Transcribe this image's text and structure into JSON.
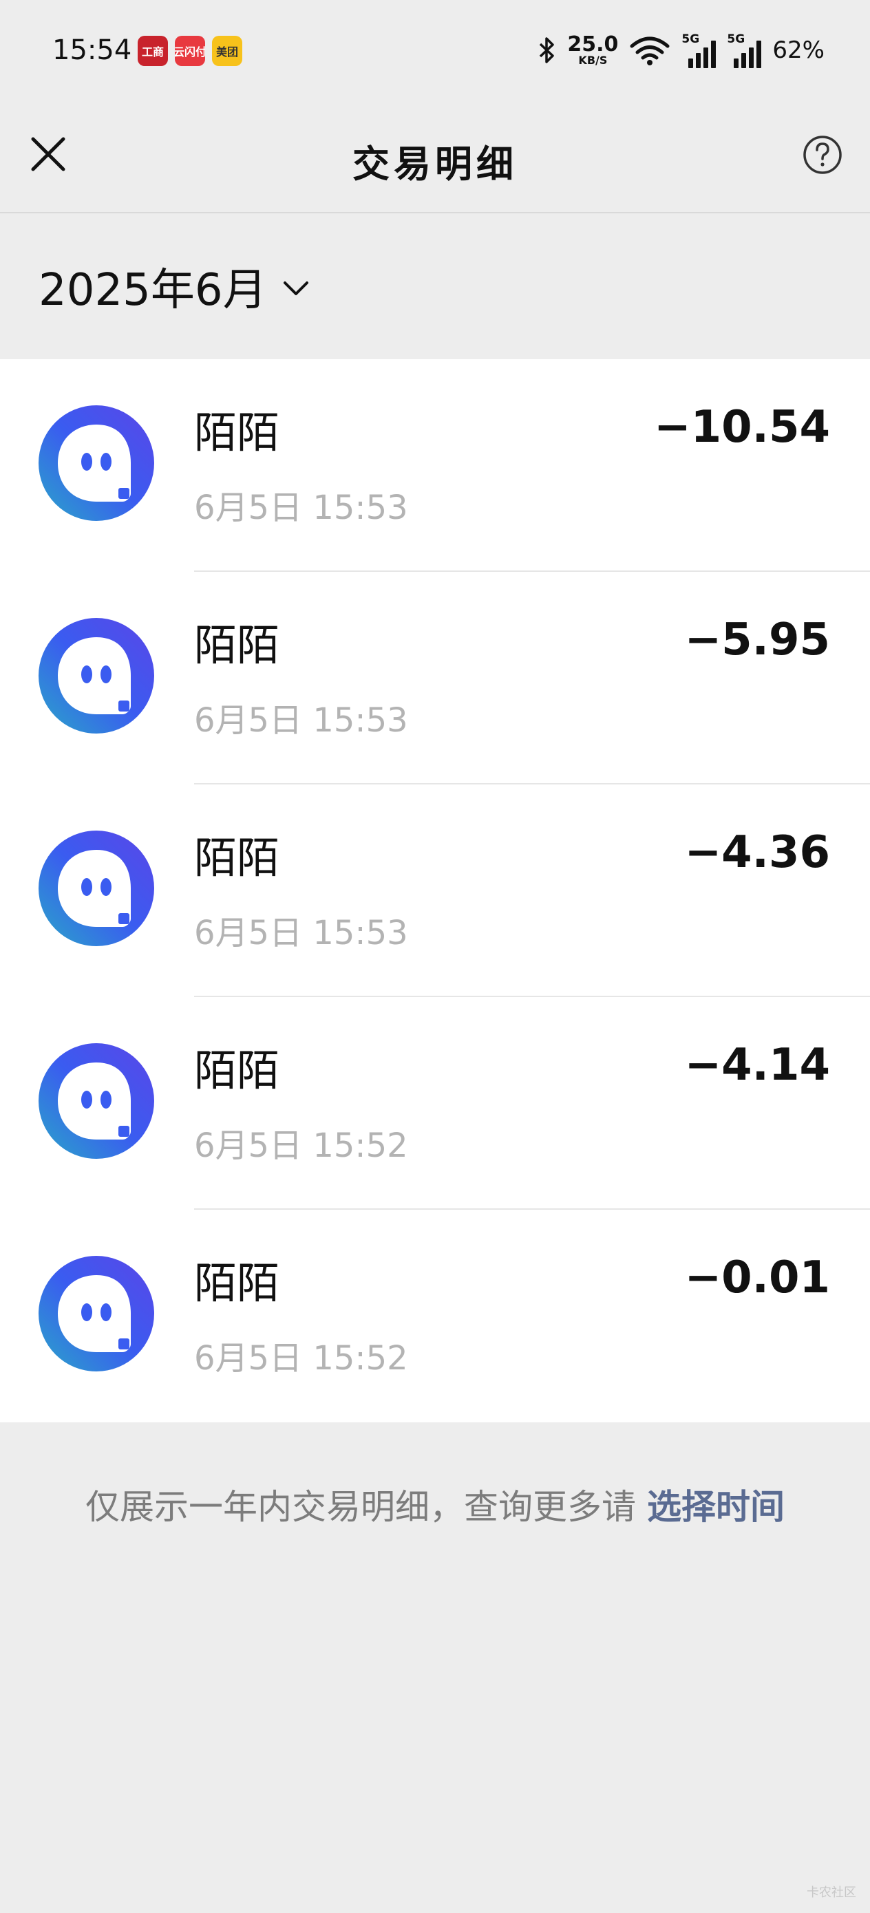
{
  "status_bar": {
    "time": "15:54",
    "apps": [
      "工商",
      "云闪付",
      "美团"
    ],
    "net_speed": "25.0",
    "net_unit": "KB/S",
    "signal_label": "5G",
    "battery": "62%"
  },
  "nav": {
    "title": "交易明细",
    "close_icon": "close-icon",
    "help_icon": "help-icon"
  },
  "month_selector": {
    "label": "2025年6月"
  },
  "transactions": [
    {
      "name": "陌陌",
      "time": "6月5日 15:53",
      "amount": "−10.54"
    },
    {
      "name": "陌陌",
      "time": "6月5日 15:53",
      "amount": "−5.95"
    },
    {
      "name": "陌陌",
      "time": "6月5日 15:53",
      "amount": "−4.36"
    },
    {
      "name": "陌陌",
      "time": "6月5日 15:52",
      "amount": "−4.14"
    },
    {
      "name": "陌陌",
      "time": "6月5日 15:52",
      "amount": "−0.01"
    }
  ],
  "footer": {
    "note": "仅展示一年内交易明细，查询更多请 ",
    "link": "选择时间"
  },
  "watermark": "卡农社区",
  "colors": {
    "background": "#ededed",
    "link": "#5a6b92",
    "icon_blue": "#3a5cf0",
    "icon_teal": "#2aa6c8"
  }
}
